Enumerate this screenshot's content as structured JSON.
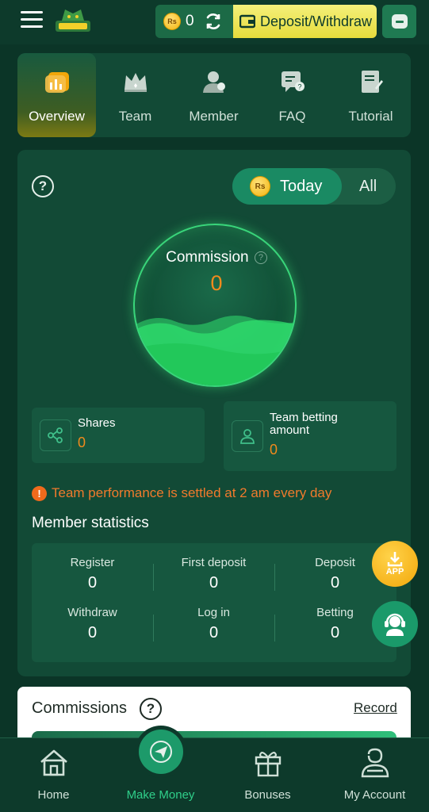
{
  "header": {
    "balance": "0",
    "coin_label": "Rs",
    "deposit_withdraw_label": "Deposit/Withdraw"
  },
  "tabs": [
    {
      "label": "Overview",
      "icon": "chart-icon",
      "active": true
    },
    {
      "label": "Team",
      "icon": "crown-icon",
      "active": false
    },
    {
      "label": "Member",
      "icon": "member-icon",
      "active": false
    },
    {
      "label": "FAQ",
      "icon": "faq-icon",
      "active": false
    },
    {
      "label": "Tutorial",
      "icon": "tutorial-icon",
      "active": false
    }
  ],
  "panel": {
    "toggle_today": "Today",
    "toggle_all": "All",
    "commission_label": "Commission",
    "commission_value": "0",
    "shares_label": "Shares",
    "shares_value": "0",
    "team_betting_label": "Team betting amount",
    "team_betting_value": "0",
    "notice": "Team performance is settled at 2 am every day",
    "member_statistics_title": "Member statistics",
    "stats": [
      {
        "label": "Register",
        "value": "0"
      },
      {
        "label": "First deposit",
        "value": "0"
      },
      {
        "label": "Deposit",
        "value": "0"
      },
      {
        "label": "Withdraw",
        "value": "0"
      },
      {
        "label": "Log in",
        "value": "0"
      },
      {
        "label": "Betting",
        "value": "0"
      }
    ]
  },
  "floating": {
    "app_label": "APP"
  },
  "commissions": {
    "title": "Commissions",
    "record_label": "Record"
  },
  "bottom_nav": [
    {
      "label": "Home",
      "icon": "home-icon"
    },
    {
      "label": "Make Money",
      "icon": "paper-plane-icon",
      "active": true
    },
    {
      "label": "Bonuses",
      "icon": "gift-icon"
    },
    {
      "label": "My Account",
      "icon": "account-icon"
    }
  ],
  "colors": {
    "background": "#0b3527",
    "panel": "#124a36",
    "accent_yellow": "#e6dc3c",
    "accent_orange": "#f08a1c",
    "accent_green": "#2fcf8a"
  }
}
